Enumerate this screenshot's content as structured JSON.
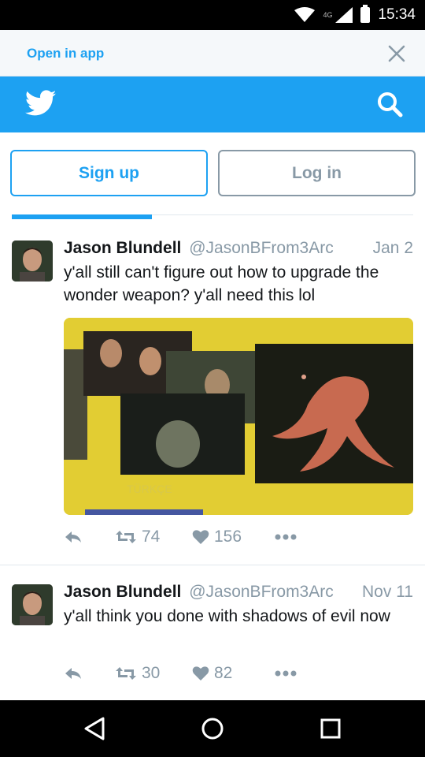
{
  "status_bar": {
    "time": "15:34",
    "network": "4G"
  },
  "open_app": {
    "label": "Open in app"
  },
  "header": {
    "logo": "twitter-bird-icon",
    "search": "search-icon",
    "brand_color": "#1da1f2"
  },
  "auth": {
    "signup_label": "Sign up",
    "login_label": "Log in"
  },
  "tweets": [
    {
      "name": "Jason Blundell",
      "handle": "@JasonBFrom3Arc",
      "date": "Jan 2",
      "text": "y'all still can't figure out how to upgrade the wonder weapon? y'all need this lol",
      "media_caption": "TÜRKÇE",
      "retweets": "74",
      "likes": "156"
    },
    {
      "name": "Jason Blundell",
      "handle": "@JasonBFrom3Arc",
      "date": "Nov 11",
      "text": "y'all think you done with shadows of evil now",
      "retweets": "30",
      "likes": "82"
    }
  ],
  "nav": {
    "back": "back-icon",
    "home": "home-icon",
    "recents": "recents-icon"
  }
}
